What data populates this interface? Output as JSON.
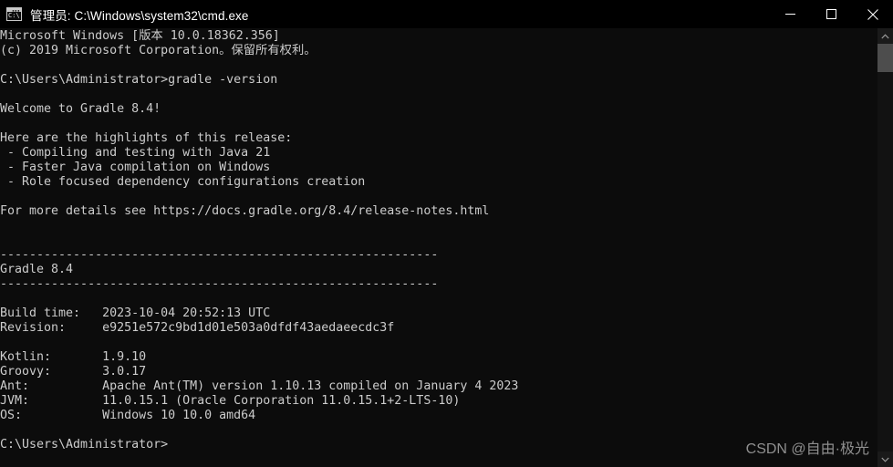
{
  "window": {
    "title": "管理员: C:\\Windows\\system32\\cmd.exe",
    "icon_label": "C:\\.",
    "icon_dots": "▪▪▪",
    "colors": {
      "titlebar_bg": "#000000",
      "terminal_bg": "#0c0c0c",
      "terminal_fg": "#cccccc",
      "scrollbar_track": "#121212",
      "scrollbar_thumb": "#4d4d4d"
    },
    "controls": {
      "minimize": "—",
      "maximize": "□",
      "close": "✕"
    }
  },
  "scrollbar": {
    "up_arrow": "˄",
    "down_arrow": "˅"
  },
  "watermark": {
    "text": "CSDN @自由·极光"
  },
  "terminal": {
    "lines": [
      "Microsoft Windows [版本 10.0.18362.356]",
      "(c) 2019 Microsoft Corporation。保留所有权利。",
      "",
      "C:\\Users\\Administrator>gradle -version",
      "",
      "Welcome to Gradle 8.4!",
      "",
      "Here are the highlights of this release:",
      " - Compiling and testing with Java 21",
      " - Faster Java compilation on Windows",
      " - Role focused dependency configurations creation",
      "",
      "For more details see https://docs.gradle.org/8.4/release-notes.html",
      "",
      "",
      "------------------------------------------------------------",
      "Gradle 8.4",
      "------------------------------------------------------------",
      "",
      "Build time:   2023-10-04 20:52:13 UTC",
      "Revision:     e9251e572c9bd1d01e503a0dfdf43aedaeecdc3f",
      "",
      "Kotlin:       1.9.10",
      "Groovy:       3.0.17",
      "Ant:          Apache Ant(TM) version 1.10.13 compiled on January 4 2023",
      "JVM:          11.0.15.1 (Oracle Corporation 11.0.15.1+2-LTS-10)",
      "OS:           Windows 10 10.0 amd64",
      "",
      "C:\\Users\\Administrator>"
    ],
    "command": "gradle -version",
    "prompt": "C:\\Users\\Administrator>",
    "gradle_info": {
      "version": "Gradle 8.4",
      "welcome": "Welcome to Gradle 8.4!",
      "highlights_header": "Here are the highlights of this release:",
      "highlights": [
        "Compiling and testing with Java 21",
        "Faster Java compilation on Windows",
        "Role focused dependency configurations creation"
      ],
      "release_notes_url": "https://docs.gradle.org/8.4/release-notes.html",
      "build_time": "2023-10-04 20:52:13 UTC",
      "revision": "e9251e572c9bd1d01e503a0dfdf43aedaeecdc3f",
      "kotlin": "1.9.10",
      "groovy": "3.0.17",
      "ant": "Apache Ant(TM) version 1.10.13 compiled on January 4 2023",
      "jvm": "11.0.15.1 (Oracle Corporation 11.0.15.1+2-LTS-10)",
      "os": "Windows 10 10.0 amd64"
    }
  }
}
